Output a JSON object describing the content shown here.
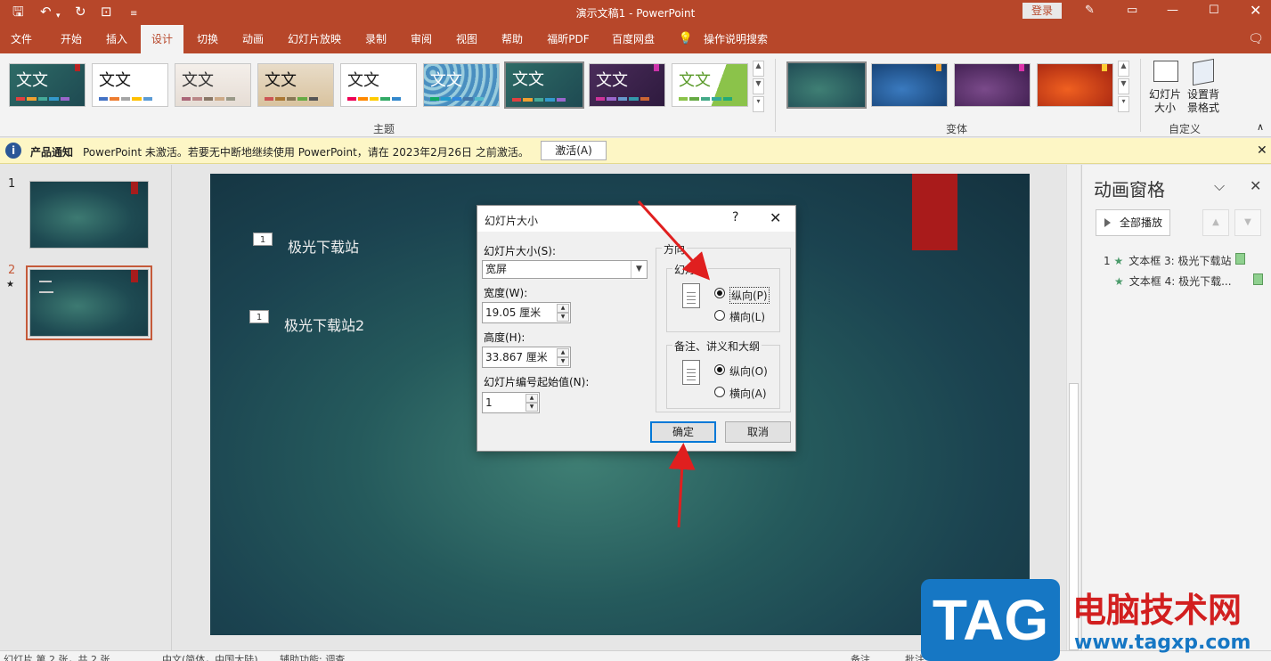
{
  "window": {
    "title": "演示文稿1  -  PowerPoint",
    "login_label": "登录"
  },
  "tabs": [
    "文件",
    "开始",
    "插入",
    "设计",
    "切换",
    "动画",
    "幻灯片放映",
    "录制",
    "审阅",
    "视图",
    "帮助",
    "福昕PDF",
    "百度网盘",
    "操作说明搜索"
  ],
  "active_tab": "设计",
  "ribbon": {
    "theme_sample_text": "文文",
    "themes_group_label": "主题",
    "variants_group_label": "变体",
    "customize_group_label": "自定义",
    "slide_size_label": "幻灯片\n大小",
    "format_bg_label": "设置背\n景格式"
  },
  "notification": {
    "title": "产品通知",
    "message": "PowerPoint 未激活。若要无中断地继续使用 PowerPoint，请在 2023年2月26日 之前激活。",
    "button": "激活(A)"
  },
  "thumbnails": {
    "slide1_num": "1",
    "slide2_num": "2",
    "slide2_star": "★"
  },
  "slide": {
    "text1_tag": "1",
    "text1": "极光下载站",
    "text2_tag": "1",
    "text2": "极光下载站2"
  },
  "animation_pane": {
    "title": "动画窗格",
    "play_all": "全部播放",
    "items": [
      {
        "num": "1",
        "star": "★",
        "label": "文本框 3: 极光下载站"
      },
      {
        "num": "",
        "star": "★",
        "label": "文本框 4: 极光下载..."
      }
    ]
  },
  "dialog": {
    "title": "幻灯片大小",
    "help": "?",
    "size_label": "幻灯片大小(S):",
    "size_value": "宽屏",
    "width_label": "宽度(W):",
    "width_value": "19.05 厘米",
    "height_label": "高度(H):",
    "height_value": "33.867 厘米",
    "start_label": "幻灯片编号起始值(N):",
    "start_value": "1",
    "orientation_label": "方向",
    "slides_group": "幻灯片",
    "slides_portrait": "纵向(P)",
    "slides_landscape": "横向(L)",
    "notes_group": "备注、讲义和大纲",
    "notes_portrait": "纵向(O)",
    "notes_landscape": "横向(A)",
    "ok": "确定",
    "cancel": "取消"
  },
  "statusbar": {
    "slide_info": "幻灯片 第 2 张，共 2 张",
    "language": "中文(简体，中国大陆)",
    "accessibility": "辅助功能: 调查",
    "notes": "备注",
    "comments": "批注"
  },
  "watermark": {
    "tag": "TAG",
    "site_name": "电脑技术网",
    "url": "www.tagxp.com"
  },
  "colors": {
    "accent": "#b7472a",
    "arrow": "#e01f1f"
  }
}
